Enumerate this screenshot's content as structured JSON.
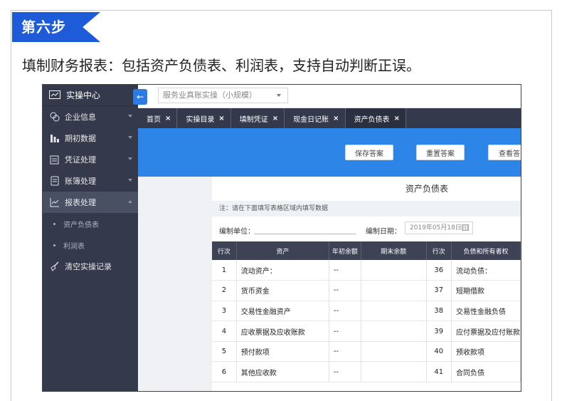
{
  "step_label": "第六步",
  "headline": "填制财务报表：包括资产负债表、利润表，支持自动判断正误。",
  "sidebar": {
    "header": "实操中心",
    "items": [
      {
        "label": "企业信息",
        "icon": "building-icon"
      },
      {
        "label": "期初数据",
        "icon": "bar-chart-icon"
      },
      {
        "label": "凭证处理",
        "icon": "voucher-icon"
      },
      {
        "label": "账簿处理",
        "icon": "ledger-icon"
      },
      {
        "label": "报表处理",
        "icon": "line-chart-icon"
      }
    ],
    "sub_items": [
      "资产负债表",
      "利润表"
    ],
    "clear": "清空实操记录"
  },
  "topbar": {
    "select_value": "服务业真账实操（小规模）"
  },
  "tabs": [
    "首页",
    "实操目录",
    "填制凭证",
    "现金日记账",
    "资产负债表"
  ],
  "buttons": [
    "保存答案",
    "重置答案",
    "查看答"
  ],
  "report": {
    "title": "资产负债表",
    "notice": "注：请在下面填写表格区域内填写数据",
    "unit_label": "编制单位：",
    "date_label": "编制日期：",
    "date_value": "2019年05月18日",
    "columns": [
      "行次",
      "资产",
      "年初余额",
      "期末余额",
      "行次",
      "负债和所有者权"
    ],
    "rows": [
      {
        "no": "1",
        "asset": "流动资产：",
        "begin": "--",
        "end": "",
        "no2": "36",
        "liab": "流动负债："
      },
      {
        "no": "2",
        "asset": "货币资金",
        "begin": "--",
        "end": "",
        "no2": "37",
        "liab": "短期借款"
      },
      {
        "no": "3",
        "asset": "交易性金融资产",
        "begin": "--",
        "end": "",
        "no2": "38",
        "liab": "交易性金融负债"
      },
      {
        "no": "4",
        "asset": "应收票据及应收账款",
        "begin": "--",
        "end": "",
        "no2": "39",
        "liab": "应付票据及应付账款"
      },
      {
        "no": "5",
        "asset": "预付款项",
        "begin": "--",
        "end": "",
        "no2": "40",
        "liab": "预收款项"
      },
      {
        "no": "6",
        "asset": "其他应收款",
        "begin": "--",
        "end": "",
        "no2": "41",
        "liab": "合同负债"
      }
    ]
  }
}
